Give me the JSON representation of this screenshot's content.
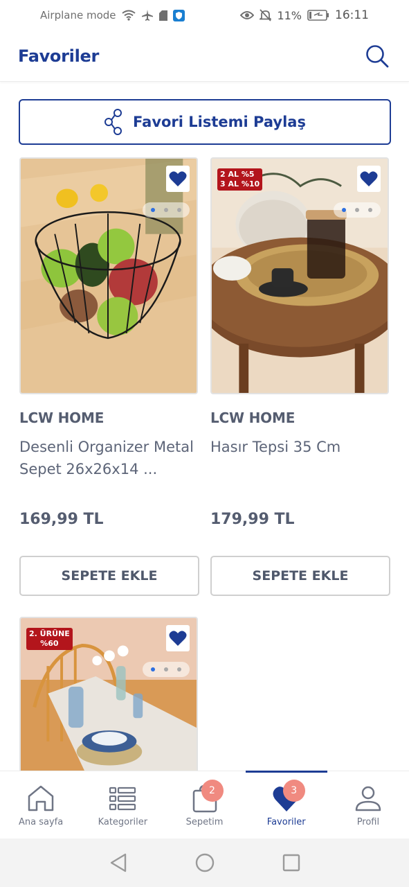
{
  "status_bar": {
    "left_text": "Airplane mode",
    "battery_pct": "11%",
    "time": "16:11"
  },
  "header": {
    "title": "Favoriler",
    "search_icon": "search-icon"
  },
  "share_button": {
    "label": "Favori Listemi Paylaş",
    "icon": "share-icon"
  },
  "products": [
    {
      "brand": "LCW HOME",
      "title": "Desenli Organizer Metal Sepet 26x26x14 ...",
      "price": "169,99 TL",
      "add_label": "SEPETE EKLE",
      "badge": ""
    },
    {
      "brand": "LCW HOME",
      "title": "Hasır Tepsi 35 Cm",
      "price": "179,99 TL",
      "add_label": "SEPETE EKLE",
      "badge_line1": "2 AL %5",
      "badge_line2": "3 AL %10"
    },
    {
      "badge_line1": "2. ÜRÜNE",
      "badge_line2": "%60"
    }
  ],
  "bottom_nav": [
    {
      "label": "Ana sayfa",
      "icon": "home-icon"
    },
    {
      "label": "Kategoriler",
      "icon": "list-icon"
    },
    {
      "label": "Sepetim",
      "icon": "bag-icon",
      "badge": "2"
    },
    {
      "label": "Favoriler",
      "icon": "heart-icon",
      "badge": "3",
      "active": true
    },
    {
      "label": "Profil",
      "icon": "user-icon"
    }
  ],
  "colors": {
    "brand_blue": "#1d3c94",
    "badge_red": "#b3151c",
    "nav_badge": "#f08a80"
  }
}
